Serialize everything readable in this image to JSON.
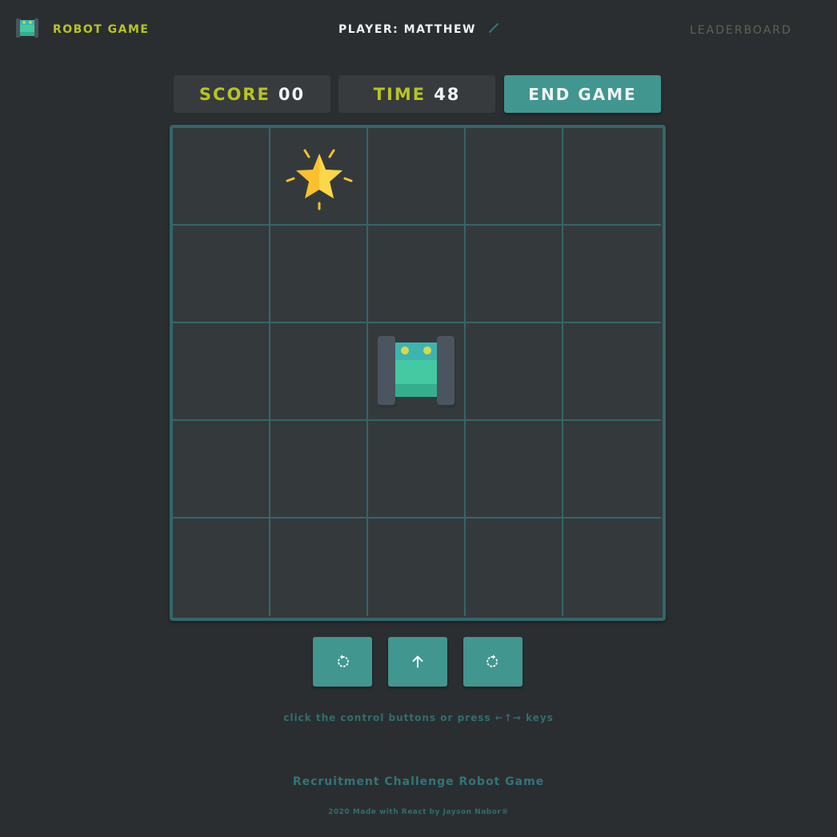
{
  "header": {
    "app_title": "ROBOT GAME",
    "player_label": "PLAYER: MATTHEW",
    "leaderboard_label": "LEADERBOARD",
    "logo_icon": "robot-icon",
    "edit_icon": "pencil-icon"
  },
  "stats": {
    "score_label": "SCORE",
    "score_value": "00",
    "time_label": "TIME",
    "time_value": "48",
    "end_button_label": "END GAME"
  },
  "board": {
    "rows": 5,
    "cols": 5,
    "star": {
      "row": 0,
      "col": 1,
      "icon": "star-icon"
    },
    "robot": {
      "row": 2,
      "col": 2,
      "facing": "up",
      "icon": "robot-icon"
    }
  },
  "controls": [
    {
      "name": "rotate-left-button",
      "icon": "rotate-left-icon"
    },
    {
      "name": "move-forward-button",
      "icon": "arrow-up-icon"
    },
    {
      "name": "rotate-right-button",
      "icon": "rotate-right-icon"
    }
  ],
  "hint": "click the control buttons or press ←↑→ keys",
  "footer": {
    "title": "Recruitment Challenge Robot Game",
    "credit": "2020 Made with React by Jayson Nabor®"
  },
  "colors": {
    "background": "#2b2e30",
    "accent_yellow": "#b8c422",
    "teal_button": "#419690",
    "grid_line": "#33666a"
  }
}
